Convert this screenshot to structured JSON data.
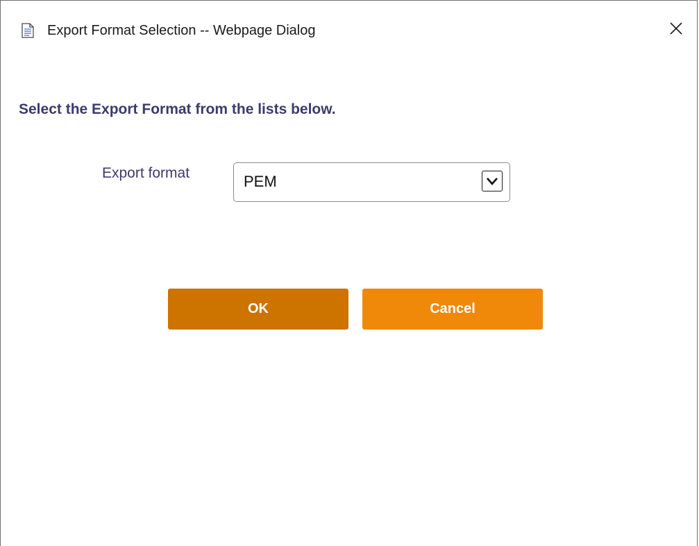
{
  "window": {
    "title": "Export Format Selection -- Webpage Dialog",
    "close_label": "×"
  },
  "dialog": {
    "heading": "Select the Export Format from the lists below.",
    "format_label": "Export format",
    "format_select": {
      "selected": "PEM"
    }
  },
  "buttons": {
    "ok_label": "OK",
    "cancel_label": "Cancel"
  },
  "colors": {
    "heading_text": "#3b3b6b",
    "ok_button": "#cc7300",
    "cancel_button": "#f0890a"
  },
  "icons": {
    "title_icon": "document-icon",
    "close_icon": "close-icon",
    "dropdown_icon": "chevron-down-icon"
  }
}
